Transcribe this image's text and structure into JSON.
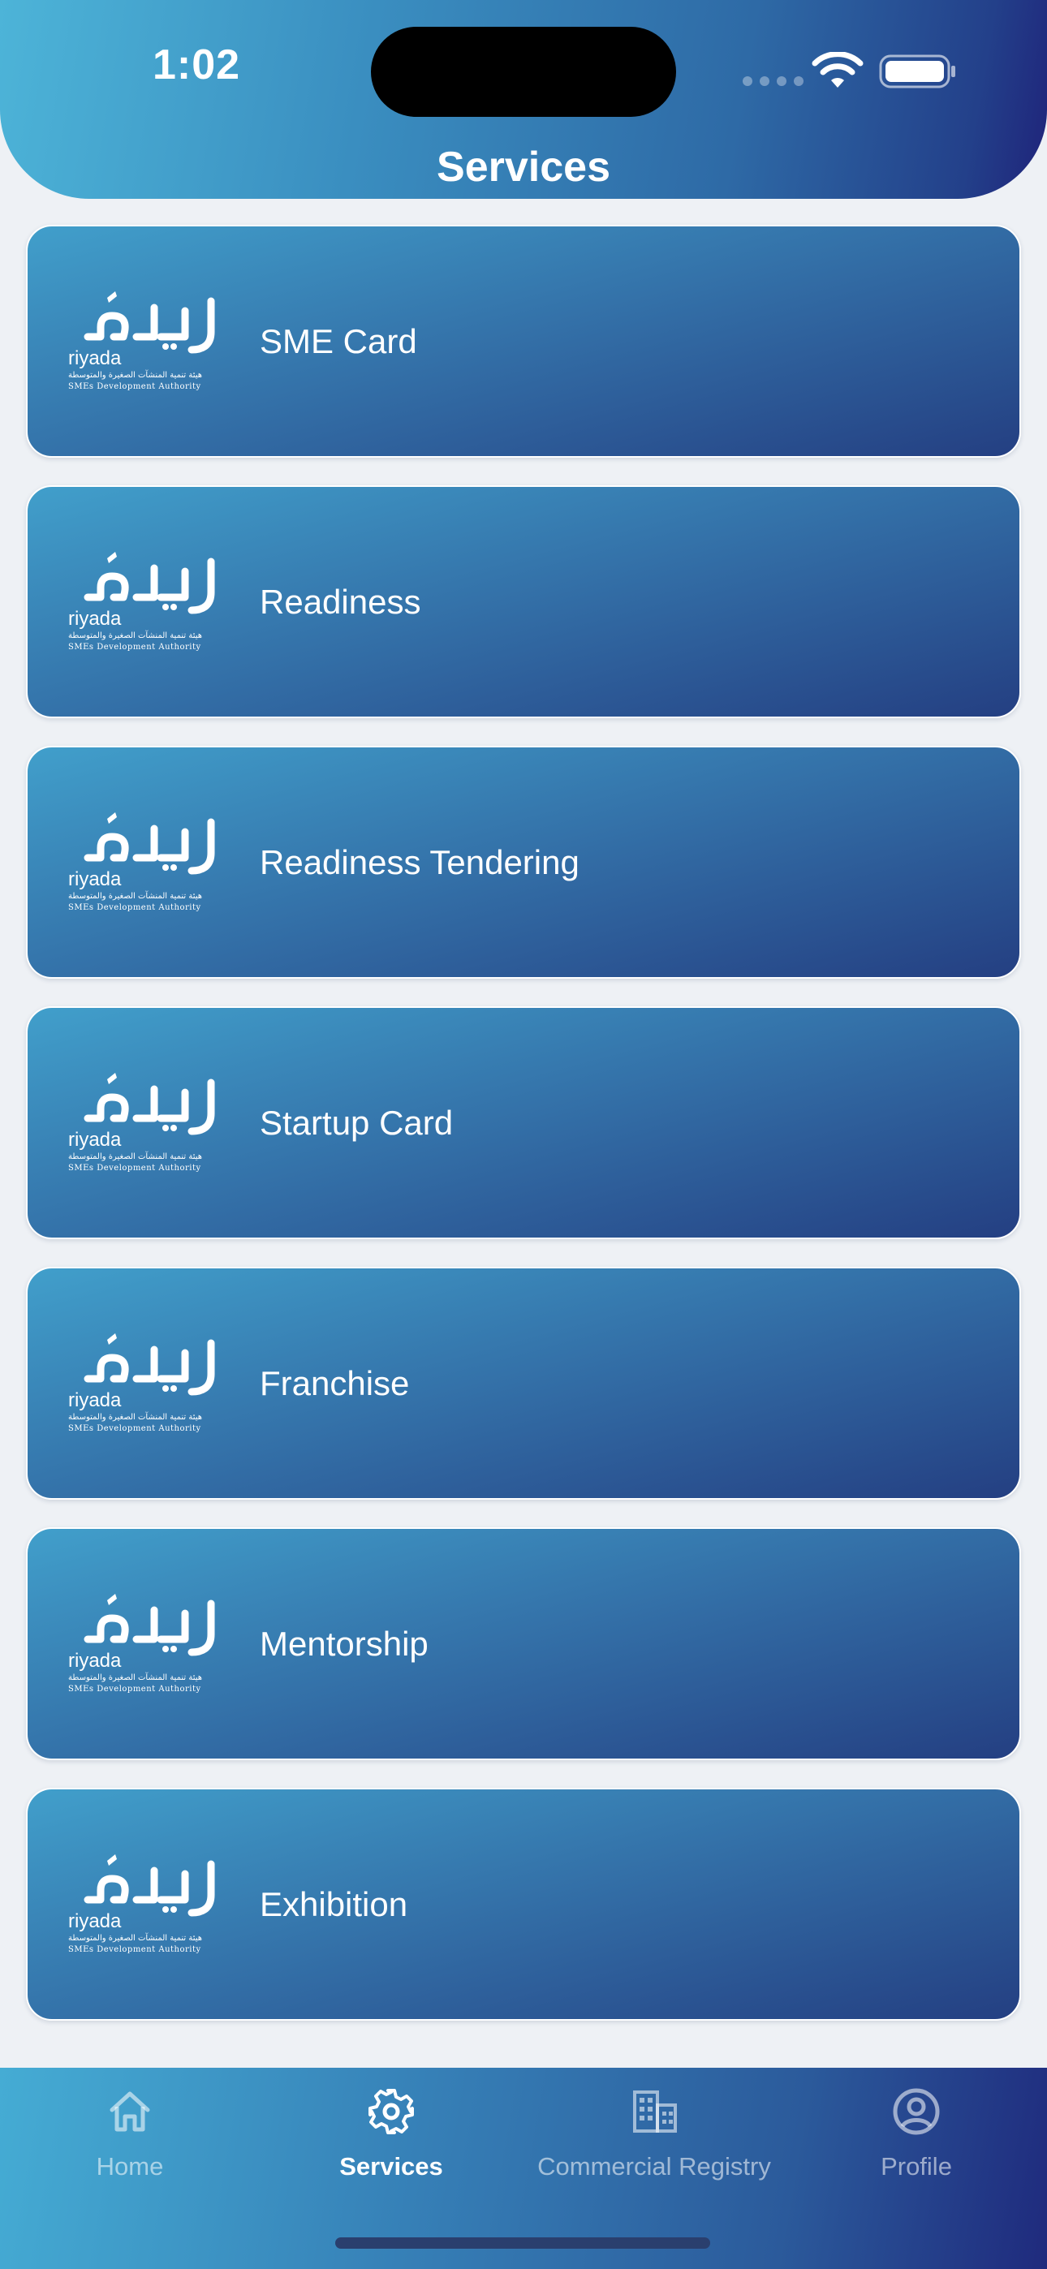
{
  "status_bar": {
    "time": "1:02"
  },
  "header": {
    "title": "Services"
  },
  "colors": {
    "accent_light": "#4db4d8",
    "accent_dark": "#1f237a",
    "background": "#eef1f5"
  },
  "logo": {
    "arabic_text": "ريادة",
    "latin_text": "riyada",
    "subtitle_arabic": "هيئة تنمية المنشآت الصغيرة والمتوسطة",
    "subtitle_english": "SMEs Development Authority"
  },
  "services": [
    {
      "label": "SME Card"
    },
    {
      "label": "Readiness"
    },
    {
      "label": "Readiness Tendering"
    },
    {
      "label": "Startup Card"
    },
    {
      "label": "Franchise"
    },
    {
      "label": "Mentorship"
    },
    {
      "label": "Exhibition"
    }
  ],
  "tabbar": {
    "items": [
      {
        "label": "Home",
        "icon": "home-icon",
        "active": false
      },
      {
        "label": "Services",
        "icon": "gear-icon",
        "active": true
      },
      {
        "label": "Commercial Registry",
        "icon": "building-icon",
        "active": false
      },
      {
        "label": "Profile",
        "icon": "user-circle-icon",
        "active": false
      }
    ]
  }
}
